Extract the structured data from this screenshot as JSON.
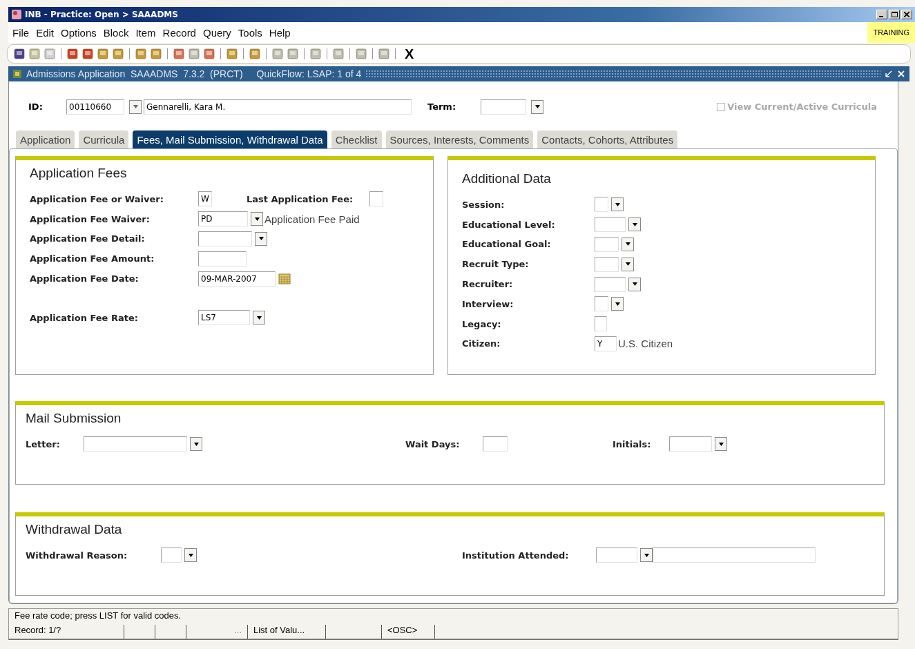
{
  "window": {
    "title": "INB - Practice: Open > SAAADMS"
  },
  "menu": [
    "File",
    "Edit",
    "Options",
    "Block",
    "Item",
    "Record",
    "Query",
    "Tools",
    "Help"
  ],
  "env_badge": "TRAINING",
  "toolbar": {
    "exit_label": "X"
  },
  "form": {
    "title": "Admissions Application  SAAADMS  7.3.2  (PRCT)",
    "quickflow": "QuickFlow: LSAP: 1 of 4"
  },
  "key_block": {
    "id_label": "ID:",
    "id_value": "00110660",
    "name_value": "Gennarelli, Kara M.",
    "term_label": "Term:",
    "curricula_checkbox": {
      "label": "View Current/Active Curricula",
      "checked": false,
      "disabled": true
    }
  },
  "tabs": [
    {
      "label": "Application",
      "selected": false
    },
    {
      "label": "Curricula",
      "selected": false
    },
    {
      "label": "Fees, Mail Submission, Withdrawal Data",
      "selected": true
    },
    {
      "label": "Checklist",
      "selected": false
    },
    {
      "label": "Sources, Interests, Comments",
      "selected": false
    },
    {
      "label": "Contacts, Cohorts, Attributes",
      "selected": false
    }
  ],
  "application_fees": {
    "title": "Application Fees",
    "fields": [
      {
        "label": "Application Fee or Waiver:",
        "kind": "text",
        "value": "W",
        "side": {
          "label": "Last Application Fee:"
        }
      },
      {
        "label": "Application Fee Waiver:",
        "kind": "dropdown",
        "value": "PD",
        "description": "Application Fee Paid"
      },
      {
        "label": "Application Fee Detail:",
        "kind": "dropdown"
      },
      {
        "label": "Application Fee Amount:",
        "kind": "text"
      },
      {
        "label": "Application Fee Date:",
        "kind": "date",
        "value": "09-MAR-2007"
      },
      {
        "label": "Application Fee Rate:",
        "kind": "dropdown",
        "value": "LS7"
      }
    ]
  },
  "additional_data": {
    "title": "Additional Data",
    "fields": [
      {
        "label": "Session:",
        "kind": "dropdown"
      },
      {
        "label": "Educational Level:",
        "kind": "dropdown"
      },
      {
        "label": "Educational Goal:",
        "kind": "dropdown"
      },
      {
        "label": "Recruit Type:",
        "kind": "dropdown"
      },
      {
        "label": "Recruiter:",
        "kind": "dropdown"
      },
      {
        "label": "Interview:",
        "kind": "dropdown"
      },
      {
        "label": "Legacy:",
        "kind": "text"
      },
      {
        "label": "Citizen:",
        "kind": "text",
        "value": "Y",
        "description": "U.S. Citizen"
      }
    ]
  },
  "mail_submission": {
    "title": "Mail Submission",
    "fields": [
      {
        "label": "Letter:",
        "kind": "dropdown"
      },
      {
        "label": "Wait Days:",
        "kind": "text"
      },
      {
        "label": "Initials:",
        "kind": "dropdown"
      }
    ]
  },
  "withdrawal_data": {
    "title": "Withdrawal Data",
    "fields": [
      {
        "label": "Withdrawal Reason:",
        "kind": "dropdown"
      },
      {
        "label": "Institution Attended:",
        "kind": "dropdown",
        "description_field": true
      }
    ]
  },
  "status_bar": {
    "message": "Fee rate code; press LIST for valid codes.",
    "record": "Record: 1/?",
    "column_4": "...",
    "column_5": "List of Valu...",
    "column_7": "<OSC>"
  }
}
